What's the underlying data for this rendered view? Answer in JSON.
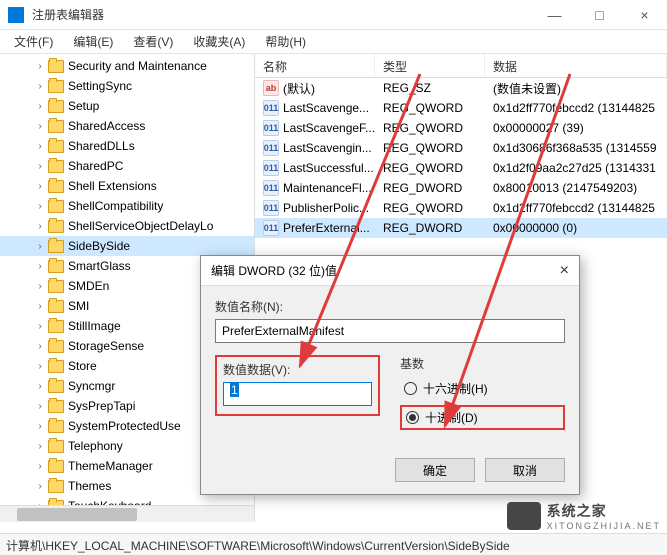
{
  "window": {
    "title": "注册表编辑器",
    "min": "—",
    "max": "□",
    "close": "×"
  },
  "menu": [
    "文件(F)",
    "编辑(E)",
    "查看(V)",
    "收藏夹(A)",
    "帮助(H)"
  ],
  "tree": [
    "Security and Maintenance",
    "SettingSync",
    "Setup",
    "SharedAccess",
    "SharedDLLs",
    "SharedPC",
    "Shell Extensions",
    "ShellCompatibility",
    "ShellServiceObjectDelayLo",
    "SideBySide",
    "SmartGlass",
    "SMDEn",
    "SMI",
    "StillImage",
    "StorageSense",
    "Store",
    "Syncmgr",
    "SysPrepTapi",
    "SystemProtectedUse",
    "Telephony",
    "ThemeManager",
    "Themes",
    "TouchKeyboard"
  ],
  "tree_selected_index": 9,
  "list": {
    "headers": {
      "name": "名称",
      "type": "类型",
      "data": "数据"
    },
    "rows": [
      {
        "icon": "sz",
        "name": "(默认)",
        "type": "REG_SZ",
        "data": "(数值未设置)"
      },
      {
        "icon": "bin",
        "name": "LastScavenge...",
        "type": "REG_QWORD",
        "data": "0x1d2ff770febccd2 (13144825"
      },
      {
        "icon": "bin",
        "name": "LastScavengeF...",
        "type": "REG_QWORD",
        "data": "0x00000027 (39)"
      },
      {
        "icon": "bin",
        "name": "LastScavengin...",
        "type": "REG_QWORD",
        "data": "0x1d30686f368a535 (1314559"
      },
      {
        "icon": "bin",
        "name": "LastSuccessful...",
        "type": "REG_QWORD",
        "data": "0x1d2f09aa2c27d25 (1314331"
      },
      {
        "icon": "bin",
        "name": "MaintenanceFl...",
        "type": "REG_DWORD",
        "data": "0x80010013 (2147549203)"
      },
      {
        "icon": "bin",
        "name": "PublisherPolic...",
        "type": "REG_QWORD",
        "data": "0x1d2ff770febccd2 (13144825"
      },
      {
        "icon": "bin",
        "name": "PreferExternal...",
        "type": "REG_DWORD",
        "data": "0x00000000 (0)"
      }
    ],
    "selected_index": 7
  },
  "dialog": {
    "title": "编辑 DWORD (32 位)值",
    "close": "×",
    "name_label": "数值名称(N):",
    "name_value": "PreferExternalManifest",
    "value_label": "数值数据(V):",
    "value_value": "1",
    "base_label": "基数",
    "radio_hex": "十六进制(H)",
    "radio_dec": "十进制(D)",
    "ok": "确定",
    "cancel": "取消"
  },
  "statusbar": "计算机\\HKEY_LOCAL_MACHINE\\SOFTWARE\\Microsoft\\Windows\\CurrentVersion\\SideBySide",
  "watermark": {
    "text": "系统之家",
    "sub": "XITONGZHIJIA.NET"
  },
  "icons": {
    "sz_glyph": "ab",
    "bin_glyph": "011"
  }
}
